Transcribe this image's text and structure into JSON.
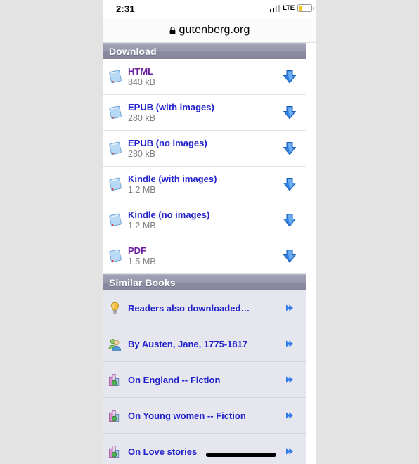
{
  "status_bar": {
    "time": "2:31",
    "network": "LTE",
    "signal_icon": "signal-bars-icon",
    "battery_icon": "battery-low-icon"
  },
  "address_bar": {
    "lock_icon": "lock-icon",
    "url": "gutenberg.org"
  },
  "download_section": {
    "header": "Download",
    "rows": [
      {
        "title": "HTML",
        "size": "840 kB",
        "visited": true,
        "file_icon": "book-file-icon",
        "action_icon": "download-arrow-icon"
      },
      {
        "title": "EPUB (with images)",
        "size": "280 kB",
        "visited": false,
        "file_icon": "book-file-icon",
        "action_icon": "download-arrow-icon"
      },
      {
        "title": "EPUB (no images)",
        "size": "280 kB",
        "visited": false,
        "file_icon": "book-file-icon",
        "action_icon": "download-arrow-icon"
      },
      {
        "title": "Kindle (with images)",
        "size": "1.2 MB",
        "visited": false,
        "file_icon": "book-file-icon",
        "action_icon": "download-arrow-icon"
      },
      {
        "title": "Kindle (no images)",
        "size": "1.2 MB",
        "visited": false,
        "file_icon": "book-file-icon",
        "action_icon": "download-arrow-icon"
      },
      {
        "title": "PDF",
        "size": "1.5 MB",
        "visited": true,
        "file_icon": "book-file-icon",
        "action_icon": "download-arrow-icon"
      }
    ]
  },
  "similar_books_section": {
    "header": "Similar Books",
    "rows": [
      {
        "label": "Readers also downloaded…",
        "icon": "lightbulb-icon",
        "chevron_icon": "chevron-right-icon",
        "redacted": false
      },
      {
        "label": "By Austen, Jane, 1775-1817",
        "icon": "people-icon",
        "chevron_icon": "chevron-right-icon",
        "redacted": false
      },
      {
        "label": "On England -- Fiction",
        "icon": "subject-icon",
        "chevron_icon": "chevron-right-icon",
        "redacted": false
      },
      {
        "label": "On Young women -- Fiction",
        "icon": "subject-icon",
        "chevron_icon": "chevron-right-icon",
        "redacted": false
      },
      {
        "label": "On Love stories",
        "icon": "subject-icon",
        "chevron_icon": "chevron-right-icon",
        "redacted": true
      }
    ]
  },
  "colors": {
    "page_background": "#e4e3e4",
    "screen_background": "#ffffff",
    "section_header": "#8b8ba1",
    "link": "#2222cc",
    "link_visited": "#6b219f",
    "size_text": "#808080",
    "similar_row_background": "#e6e6ef",
    "battery_fill": "#f5c518"
  }
}
